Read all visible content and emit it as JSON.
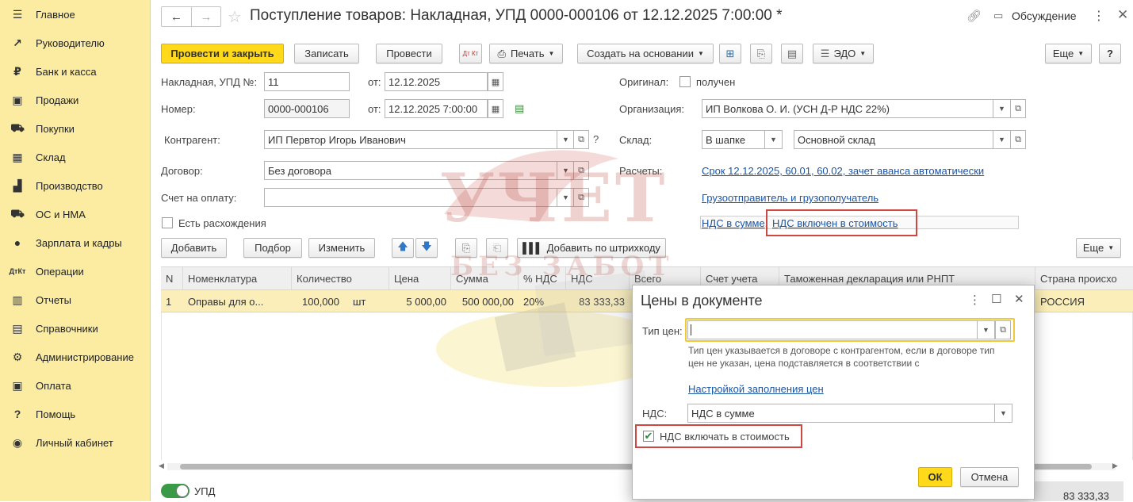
{
  "sidebar": {
    "items": [
      {
        "label": "Главное",
        "icon": "menu-icon"
      },
      {
        "label": "Руководителю",
        "icon": "trend-icon"
      },
      {
        "label": "Банк и касса",
        "icon": "ruble-icon"
      },
      {
        "label": "Продажи",
        "icon": "bag-icon"
      },
      {
        "label": "Покупки",
        "icon": "cart-icon"
      },
      {
        "label": "Склад",
        "icon": "warehouse-icon"
      },
      {
        "label": "Производство",
        "icon": "factory-icon"
      },
      {
        "label": "ОС и НМА",
        "icon": "truck-icon"
      },
      {
        "label": "Зарплата и кадры",
        "icon": "person-icon"
      },
      {
        "label": "Операции",
        "icon": "dt-kt-icon"
      },
      {
        "label": "Отчеты",
        "icon": "bar-chart-icon"
      },
      {
        "label": "Справочники",
        "icon": "books-icon"
      },
      {
        "label": "Администрирование",
        "icon": "gear-icon"
      },
      {
        "label": "Оплата",
        "icon": "wallet-icon"
      },
      {
        "label": "Помощь",
        "icon": "question-icon"
      },
      {
        "label": "Личный кабинет",
        "icon": "user-circle-icon"
      }
    ]
  },
  "header": {
    "title": "Поступление товаров: Накладная, УПД 0000-000106 от 12.12.2025 7:00:00 *",
    "discussion": "Обсуждение"
  },
  "toolbar": {
    "post_close": "Провести и закрыть",
    "save": "Записать",
    "post": "Провести",
    "dt_kt": "Дт Кт",
    "print": "Печать",
    "create_based": "Создать на основании",
    "edo": "ЭДО",
    "more": "Еще",
    "help": "?"
  },
  "form": {
    "invoice_label": "Накладная, УПД №:",
    "invoice_no": "11",
    "from_label": "от:",
    "invoice_date": "12.12.2025",
    "number_label": "Номер:",
    "number": "0000-000106",
    "number_date": "12.12.2025  7:00:00",
    "original_label": "Оригинал:",
    "original_check": "получен",
    "org_label": "Организация:",
    "org": "ИП Волкова О. И. (УСН Д-Р НДС 22%)",
    "contractor_label": "Контрагент:",
    "contractor": "ИП Первтор Игорь Иванович",
    "warehouse_label": "Склад:",
    "warehouse_mode": "В шапке",
    "warehouse": "Основной склад",
    "contract_label": "Договор:",
    "contract": "Без договора",
    "settlements_label": "Расчеты:",
    "settlements_link": "Срок 12.12.2025, 60.01, 60.02, зачет аванса автоматически",
    "invoice_pay_label": "Счет на оплату:",
    "shipper_link": "Грузоотправитель и грузополучатель",
    "discrepancy": "Есть расхождения",
    "vat_link_a": "НДС в сумме,",
    "vat_link_b": "НДС включен в стоимость"
  },
  "table_toolbar": {
    "add": "Добавить",
    "select": "Подбор",
    "change": "Изменить",
    "barcode": "Добавить по штрихкоду",
    "more": "Еще"
  },
  "table": {
    "columns": [
      "N",
      "Номенклатура",
      "Количество",
      "Цена",
      "Сумма",
      "% НДС",
      "НДС",
      "Всего",
      "Счет учета",
      "Таможенная декларация или РНПТ",
      "Страна происхо"
    ],
    "rows": [
      {
        "n": "1",
        "name": "Оправы для о...",
        "qty": "100,000",
        "unit": "шт",
        "price": "5 000,00",
        "sum": "500 000,00",
        "vat_rate": "20%",
        "vat": "83 333,33",
        "country": "РОССИЯ"
      }
    ]
  },
  "footer": {
    "upd_toggle": "УПД",
    "total_vat": "83 333,33"
  },
  "dialog": {
    "title": "Цены в документе",
    "price_type_label": "Тип цен:",
    "price_type_value": "",
    "hint": "Тип цен указывается в договоре с контрагентом, если в договоре тип цен не указан, цена подставляется в соответствии с",
    "hint_link": "Настройкой заполнения цен",
    "vat_label": "НДС:",
    "vat_value": "НДС в сумме",
    "vat_include": "НДС включать в стоимость",
    "ok": "ОК",
    "cancel": "Отмена"
  },
  "watermark": {
    "line1": "УЧЕТ",
    "line2": "БЕЗ ЗАБОТ"
  },
  "colors": {
    "sidebar_bg": "#fbeca2",
    "primary_btn": "#ffd91a",
    "link": "#1a55a8",
    "highlight_red": "#d0473f",
    "row_selected": "#fbeeb8"
  }
}
